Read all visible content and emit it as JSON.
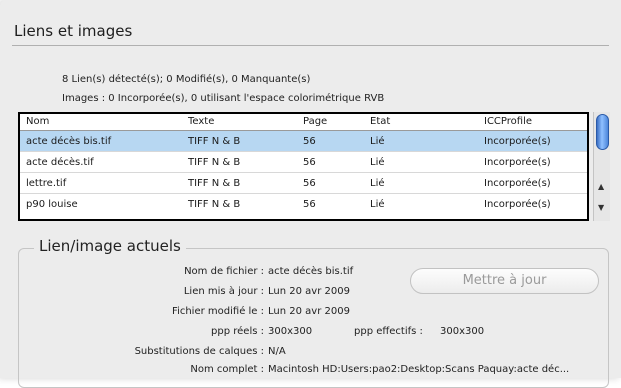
{
  "section_title": "Liens et images",
  "summary": {
    "line1": "8 Lien(s) détecté(s); 0 Modifié(s), 0 Manquante(s)",
    "line2": "Images : 0 Incorporée(s), 0 utilisant l'espace colorimétrique RVB"
  },
  "table": {
    "columns": [
      "Nom",
      "Texte",
      "Page",
      "Etat",
      "ICCProfile"
    ],
    "rows": [
      {
        "nom": "acte décès bis.tif",
        "texte": "TIFF N & B",
        "page": "56",
        "etat": "Lié",
        "icc": "Incorporée(s)"
      },
      {
        "nom": "acte décès.tif",
        "texte": "TIFF N & B",
        "page": "56",
        "etat": "Lié",
        "icc": "Incorporée(s)"
      },
      {
        "nom": "lettre.tif",
        "texte": "TIFF N & B",
        "page": "56",
        "etat": "Lié",
        "icc": "Incorporée(s)"
      },
      {
        "nom": "p90 louise",
        "texte": "TIFF N & B",
        "page": "56",
        "etat": "Lié",
        "icc": "Incorporée(s)"
      }
    ]
  },
  "current": {
    "title": "Lien/image actuels",
    "update_button": "Mettre à jour",
    "fields": {
      "filename_label": "Nom de fichier :",
      "filename_value": "acte décès bis.tif",
      "link_updated_label": "Lien mis à jour :",
      "link_updated_value": "Lun 20 avr 2009",
      "file_modified_label": "Fichier modifié le :",
      "file_modified_value": "Lun 20 avr 2009",
      "ppi_actual_label": "ppp réels :",
      "ppi_actual_value": "300x300",
      "ppi_effective_label": "ppp effectifs :",
      "ppi_effective_value": "300x300",
      "layer_overrides_label": "Substitutions de calques :",
      "layer_overrides_value": "N/A",
      "full_name_label": "Nom complet :",
      "full_name_value": "Macintosh HD:Users:pao2:Desktop:Scans Paquay:acte déc..."
    }
  },
  "colors": {
    "selected_row": "#b7d7f2",
    "panel_bg": "#ececec"
  }
}
